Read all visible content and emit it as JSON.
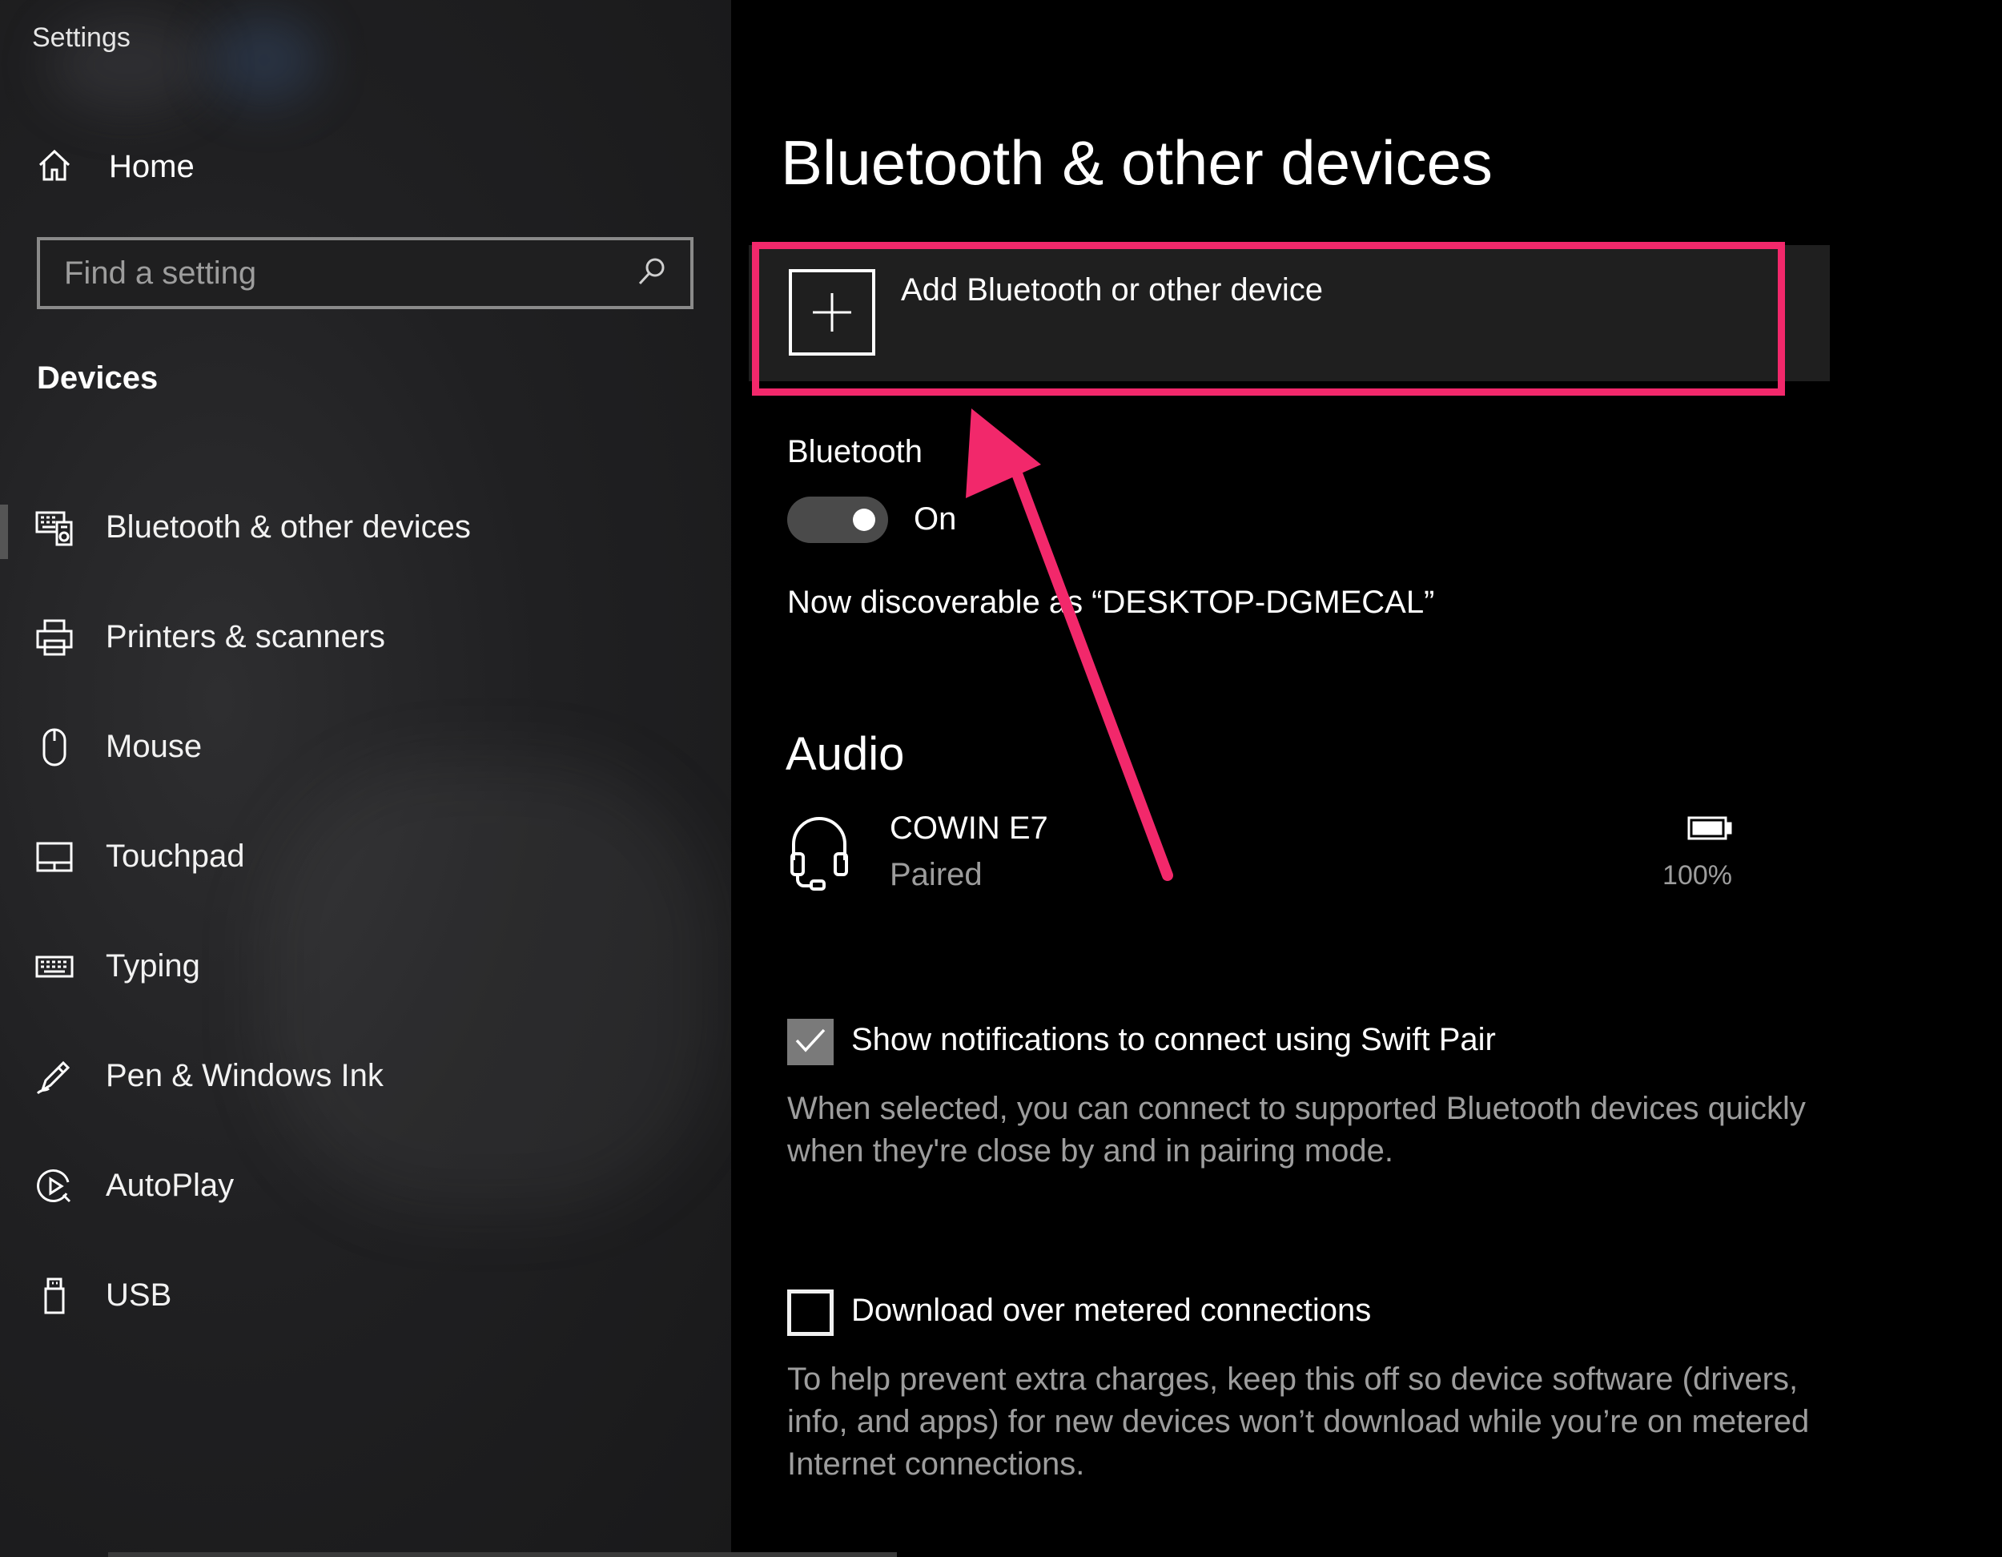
{
  "window": {
    "title": "Settings"
  },
  "sidebar": {
    "home_label": "Home",
    "search_placeholder": "Find a setting",
    "section_label": "Devices",
    "items": [
      {
        "label": "Bluetooth & other devices",
        "icon": "bluetooth-devices-icon",
        "selected": true
      },
      {
        "label": "Printers & scanners",
        "icon": "printer-icon"
      },
      {
        "label": "Mouse",
        "icon": "mouse-icon"
      },
      {
        "label": "Touchpad",
        "icon": "touchpad-icon"
      },
      {
        "label": "Typing",
        "icon": "keyboard-icon"
      },
      {
        "label": "Pen & Windows Ink",
        "icon": "pen-icon"
      },
      {
        "label": "AutoPlay",
        "icon": "autoplay-icon"
      },
      {
        "label": "USB",
        "icon": "usb-icon"
      }
    ]
  },
  "main": {
    "title": "Bluetooth & other devices",
    "add_device_label": "Add Bluetooth or other device",
    "bluetooth": {
      "label": "Bluetooth",
      "state_label": "On",
      "on": true,
      "discoverable_text": "Now discoverable as “DESKTOP-DGMECAL”"
    },
    "audio": {
      "heading": "Audio",
      "devices": [
        {
          "name": "COWIN E7",
          "status": "Paired",
          "battery": "100%",
          "icon": "headset-icon"
        }
      ]
    },
    "swift_pair": {
      "checked": true,
      "label": "Show notifications to connect using Swift Pair",
      "description": "When selected, you can connect to supported Bluetooth devices quickly when they're close by and in pairing mode."
    },
    "metered": {
      "checked": false,
      "label": "Download over metered connections",
      "description": "To help prevent extra charges, keep this off so device software (drivers, info, and apps) for new devices won’t download while you’re on metered Internet connections."
    }
  },
  "annotation": {
    "highlight_color": "#f2286b"
  },
  "colors": {
    "accent": "#f2286b",
    "sidebar_bg": "#202022",
    "secondary_text": "#9d9d9d"
  }
}
